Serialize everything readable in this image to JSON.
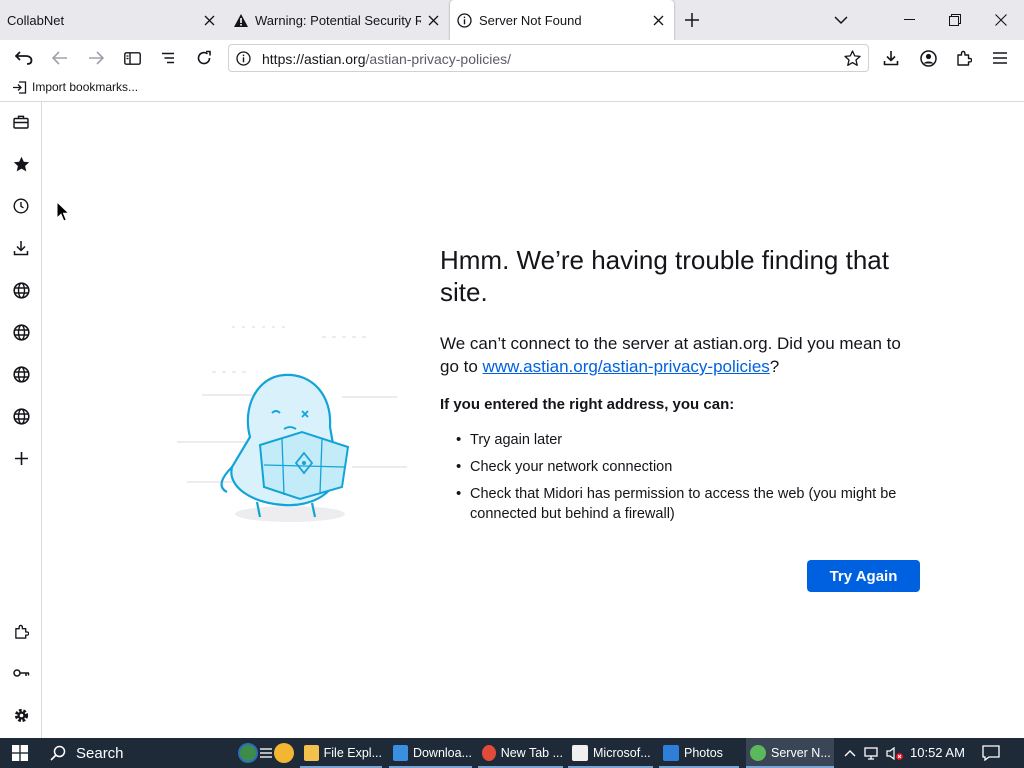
{
  "tabs": [
    {
      "title": "CollabNet",
      "icon": "none"
    },
    {
      "title": "Warning: Potential Security Risk",
      "icon": "warning-icon"
    },
    {
      "title": "Server Not Found",
      "icon": "info-icon",
      "active": true
    }
  ],
  "url": {
    "domain": "https://astian.org",
    "path": "/astian-privacy-policies/"
  },
  "bookmarks": {
    "import_label": "Import bookmarks..."
  },
  "error": {
    "title": "Hmm. We’re having trouble finding that site.",
    "desc_prefix": "We can’t connect to the server at astian.org. Did you mean to go to ",
    "suggested_link": "www.astian.org/astian-privacy-policies",
    "desc_suffix": "?",
    "sub_heading": "If you entered the right address, you can:",
    "suggestions": [
      "Try again later",
      "Check your network connection",
      "Check that Midori has permission to access the web (you might be connected but behind a firewall)"
    ],
    "try_again_label": "Try Again"
  },
  "taskbar": {
    "search_label": "Search",
    "items": [
      {
        "label": "File Expl...",
        "color": "#f2c14e"
      },
      {
        "label": "Downloa...",
        "color": "#3b8fe0"
      },
      {
        "label": "New Tab ...",
        "color": "#e04b3b"
      },
      {
        "label": "Microsof...",
        "color": "#f0f0f0"
      },
      {
        "label": "Photos",
        "color": "#2f7fd8"
      },
      {
        "label": "Server N...",
        "color": "#5cb85c"
      }
    ],
    "time": "10:52 AM"
  },
  "colors": {
    "accent": "#0061e0",
    "taskbar": "#1e2a38"
  }
}
